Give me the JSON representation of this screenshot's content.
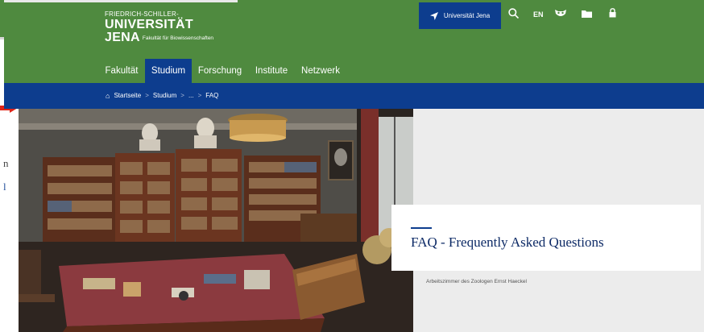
{
  "logo": {
    "line1": "FRIEDRICH-SCHILLER-",
    "line2": "UNIVERSITÄT",
    "line3": "JENA",
    "faculty": "Fakultät für Biowissenschaften"
  },
  "toolbar": {
    "university_button": "Universität Jena",
    "language": "EN"
  },
  "nav": {
    "items": [
      "Fakultät",
      "Studium",
      "Forschung",
      "Institute",
      "Netzwerk"
    ],
    "active": "Studium"
  },
  "breadcrumb": {
    "home": "Startseite",
    "items": [
      "Studium",
      "...",
      "FAQ"
    ]
  },
  "page": {
    "title": "FAQ - Frequently Asked Questions",
    "image_caption": "Arbeitszimmer des Zoologen Ernst Haeckel"
  },
  "edge_fragments": [
    "n",
    "l"
  ],
  "colors": {
    "green": "#4f8a3f",
    "blue": "#0d3d8e"
  }
}
